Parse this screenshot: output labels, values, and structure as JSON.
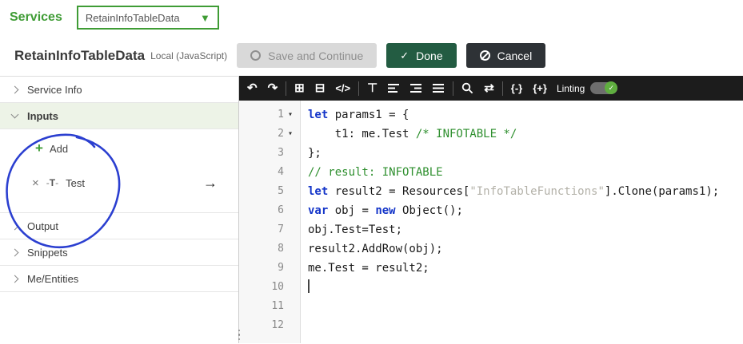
{
  "services_bar": {
    "label": "Services",
    "selected_service": "RetainInfoTableData"
  },
  "title_bar": {
    "title": "RetainInfoTableData",
    "subtitle": "Local (JavaScript)",
    "save_button": "Save and Continue",
    "done_button": "Done",
    "cancel_button": "Cancel"
  },
  "sidebar": {
    "sections": [
      {
        "label": "Service Info",
        "expanded": false
      },
      {
        "label": "Inputs",
        "expanded": true
      },
      {
        "label": "Output",
        "expanded": false
      },
      {
        "label": "Snippets",
        "expanded": false
      },
      {
        "label": "Me/Entities",
        "expanded": false
      }
    ],
    "inputs_panel": {
      "add_label": "Add",
      "items": [
        {
          "name": "Test",
          "type_glyph": "T"
        }
      ]
    }
  },
  "editor": {
    "toolbar": {
      "linting_label": "Linting",
      "linting_enabled": true,
      "icons": {
        "undo": "↶",
        "redo": "↷",
        "box_plus": "⊞",
        "box_minus": "⊟",
        "code": "</>",
        "format": "⊤",
        "replace": "⇄",
        "fold_minus": "{-}",
        "fold_plus": "{+}"
      }
    },
    "code": {
      "language": "javascript",
      "lines": [
        {
          "num": 1,
          "fold": true,
          "segments": [
            [
              "kw",
              "let"
            ],
            [
              "plain",
              " params1 = {"
            ]
          ]
        },
        {
          "num": 2,
          "fold": true,
          "segments": [
            [
              "plain",
              "    t1: me.Test "
            ],
            [
              "comment",
              "/* INFOTABLE */"
            ]
          ]
        },
        {
          "num": 3,
          "segments": [
            [
              "plain",
              "};"
            ]
          ]
        },
        {
          "num": 4,
          "segments": [
            [
              "comment",
              "// result: INFOTABLE"
            ]
          ]
        },
        {
          "num": 5,
          "segments": [
            [
              "kw",
              "let"
            ],
            [
              "plain",
              " result2 = Resources["
            ],
            [
              "string",
              "\"InfoTableFunctions\""
            ],
            [
              "plain",
              "].Clone(params1);"
            ]
          ]
        },
        {
          "num": 6,
          "segments": [
            [
              "kw",
              "var"
            ],
            [
              "plain",
              " obj = "
            ],
            [
              "kw",
              "new"
            ],
            [
              "plain",
              " Object();"
            ]
          ]
        },
        {
          "num": 7,
          "segments": [
            [
              "plain",
              "obj.Test=Test;"
            ]
          ]
        },
        {
          "num": 8,
          "segments": [
            [
              "plain",
              "result2.AddRow(obj);"
            ]
          ]
        },
        {
          "num": 9,
          "segments": [
            [
              "plain",
              "me.Test = result2;"
            ]
          ]
        },
        {
          "num": 10,
          "cursor": true,
          "segments": []
        },
        {
          "num": 11,
          "segments": []
        },
        {
          "num": 12,
          "segments": []
        }
      ]
    }
  },
  "colors": {
    "accent_green": "#3f9c35",
    "done_green": "#235c42",
    "cancel_dark": "#2e3236",
    "toggle_green": "#5fae3f",
    "annotation_blue": "#2b3fd0"
  }
}
